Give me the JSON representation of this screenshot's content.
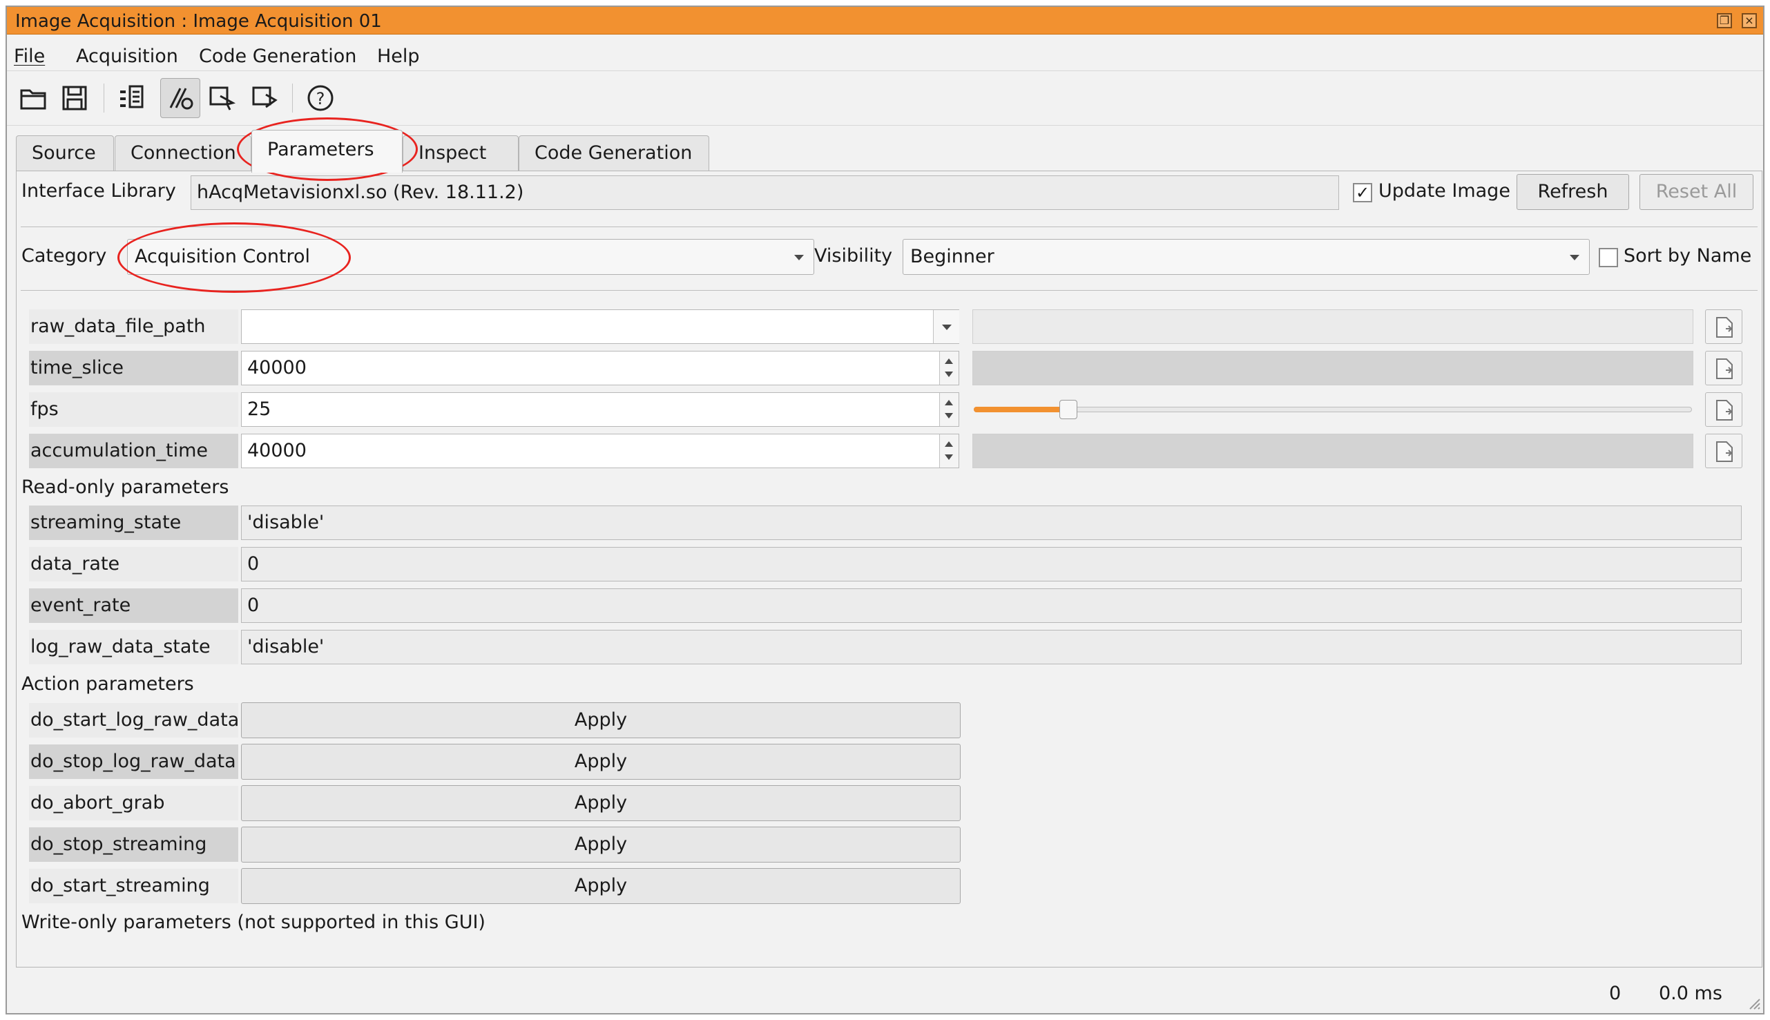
{
  "window": {
    "title": "Image Acquisition : Image Acquisition 01",
    "colors": {
      "titlebar": "#f29130",
      "highlight": "#e8231f"
    }
  },
  "menu": {
    "items": [
      {
        "label": "File"
      },
      {
        "label": "Acquisition"
      },
      {
        "label": "Code Generation"
      },
      {
        "label": "Help"
      }
    ]
  },
  "toolbar": {
    "icons": [
      "open-folder-icon",
      "save-icon",
      "detect-devices-icon",
      "connect-icon",
      "grab-icon",
      "live-icon",
      "help-icon"
    ]
  },
  "tabs": [
    {
      "label": "Source"
    },
    {
      "label": "Connection"
    },
    {
      "label": "Parameters",
      "selected": true
    },
    {
      "label": "Inspect"
    },
    {
      "label": "Code Generation"
    }
  ],
  "interface": {
    "label": "Interface Library",
    "value": "hAcqMetavisionxl.so (Rev. 18.11.2)",
    "update_image_label": "Update Image",
    "update_image_checked": true,
    "refresh_label": "Refresh",
    "reset_all_label": "Reset All"
  },
  "category": {
    "label": "Category",
    "value": "Acquisition Control",
    "visibility_label": "Visibility",
    "visibility_value": "Beginner",
    "sort_by_name_label": "Sort by Name",
    "sort_by_name_checked": false
  },
  "params": {
    "rw": [
      {
        "name": "raw_data_file_path",
        "value": "",
        "control": "combo"
      },
      {
        "name": "time_slice",
        "value": "40000",
        "control": "spin"
      },
      {
        "name": "fps",
        "value": "25",
        "control": "spin",
        "slider_fraction": 0.13
      },
      {
        "name": "accumulation_time",
        "value": "40000",
        "control": "spin"
      }
    ],
    "readonly_header": "Read-only parameters",
    "readonly": [
      {
        "name": "streaming_state",
        "value": "'disable'"
      },
      {
        "name": "data_rate",
        "value": "0"
      },
      {
        "name": "event_rate",
        "value": "0"
      },
      {
        "name": "log_raw_data_state",
        "value": "'disable'"
      }
    ],
    "action_header": "Action parameters",
    "actions": [
      {
        "name": "do_start_log_raw_data",
        "button": "Apply"
      },
      {
        "name": "do_stop_log_raw_data",
        "button": "Apply"
      },
      {
        "name": "do_abort_grab",
        "button": "Apply"
      },
      {
        "name": "do_stop_streaming",
        "button": "Apply"
      },
      {
        "name": "do_start_streaming",
        "button": "Apply"
      }
    ],
    "writeonly_header": "Write-only parameters (not supported in this GUI)"
  },
  "status": {
    "count": "0",
    "time": "0.0 ms"
  }
}
